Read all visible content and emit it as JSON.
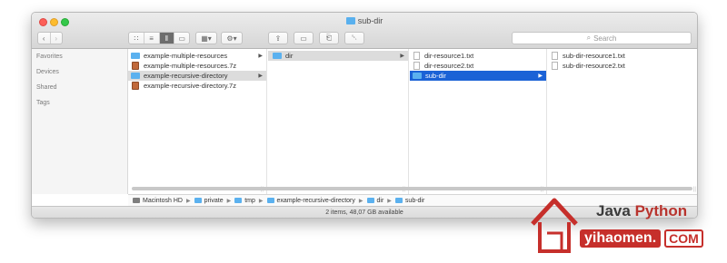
{
  "window": {
    "title": "sub-dir"
  },
  "toolbar": {
    "back_icon": "chevron-left-icon",
    "forward_icon": "chevron-right-icon",
    "view_icons": [
      "icon-view-icon",
      "list-view-icon",
      "column-view-icon",
      "gallery-view-icon"
    ],
    "group_icon": "grid-menu-icon",
    "action_icon": "gear-icon",
    "share_icon": "share-icon",
    "tag_icon": "tag-icon",
    "connect_icon": "connect-icon",
    "trash_icon": "trash-icon",
    "search_placeholder": "Search"
  },
  "sidebar": {
    "headers": [
      "Favorites",
      "Devices",
      "Shared",
      "Tags"
    ]
  },
  "columns": [
    {
      "items": [
        {
          "label": "example-multiple-resources",
          "icon": "folder-icon",
          "has_children": true,
          "selected": "none"
        },
        {
          "label": "example-multiple-resources.7z",
          "icon": "archive-icon",
          "has_children": false,
          "selected": "none"
        },
        {
          "label": "example-recursive-directory",
          "icon": "folder-icon",
          "has_children": true,
          "selected": "inactive"
        },
        {
          "label": "example-recursive-directory.7z",
          "icon": "archive-icon",
          "has_children": false,
          "selected": "none"
        }
      ]
    },
    {
      "items": [
        {
          "label": "dir",
          "icon": "folder-icon",
          "has_children": true,
          "selected": "inactive"
        }
      ]
    },
    {
      "items": [
        {
          "label": "dir-resource1.txt",
          "icon": "text-file-icon",
          "has_children": false,
          "selected": "none"
        },
        {
          "label": "dir-resource2.txt",
          "icon": "text-file-icon",
          "has_children": false,
          "selected": "none"
        },
        {
          "label": "sub-dir",
          "icon": "folder-icon",
          "has_children": true,
          "selected": "active"
        }
      ]
    },
    {
      "items": [
        {
          "label": "sub-dir-resource1.txt",
          "icon": "text-file-icon",
          "has_children": false,
          "selected": "none"
        },
        {
          "label": "sub-dir-resource2.txt",
          "icon": "text-file-icon",
          "has_children": false,
          "selected": "none"
        }
      ]
    }
  ],
  "path": [
    "Macintosh HD",
    "private",
    "tmp",
    "example-recursive-directory",
    "dir",
    "sub-dir"
  ],
  "status": "2 items, 48,07 GB available",
  "watermark": {
    "line1_a": "Java",
    "line1_b": "Python",
    "site": "yihaomen.",
    "tld": "COM"
  },
  "colors": {
    "selection": "#1b62d6",
    "folder": "#5bb1ef",
    "watermark_red": "#c62f2b"
  }
}
